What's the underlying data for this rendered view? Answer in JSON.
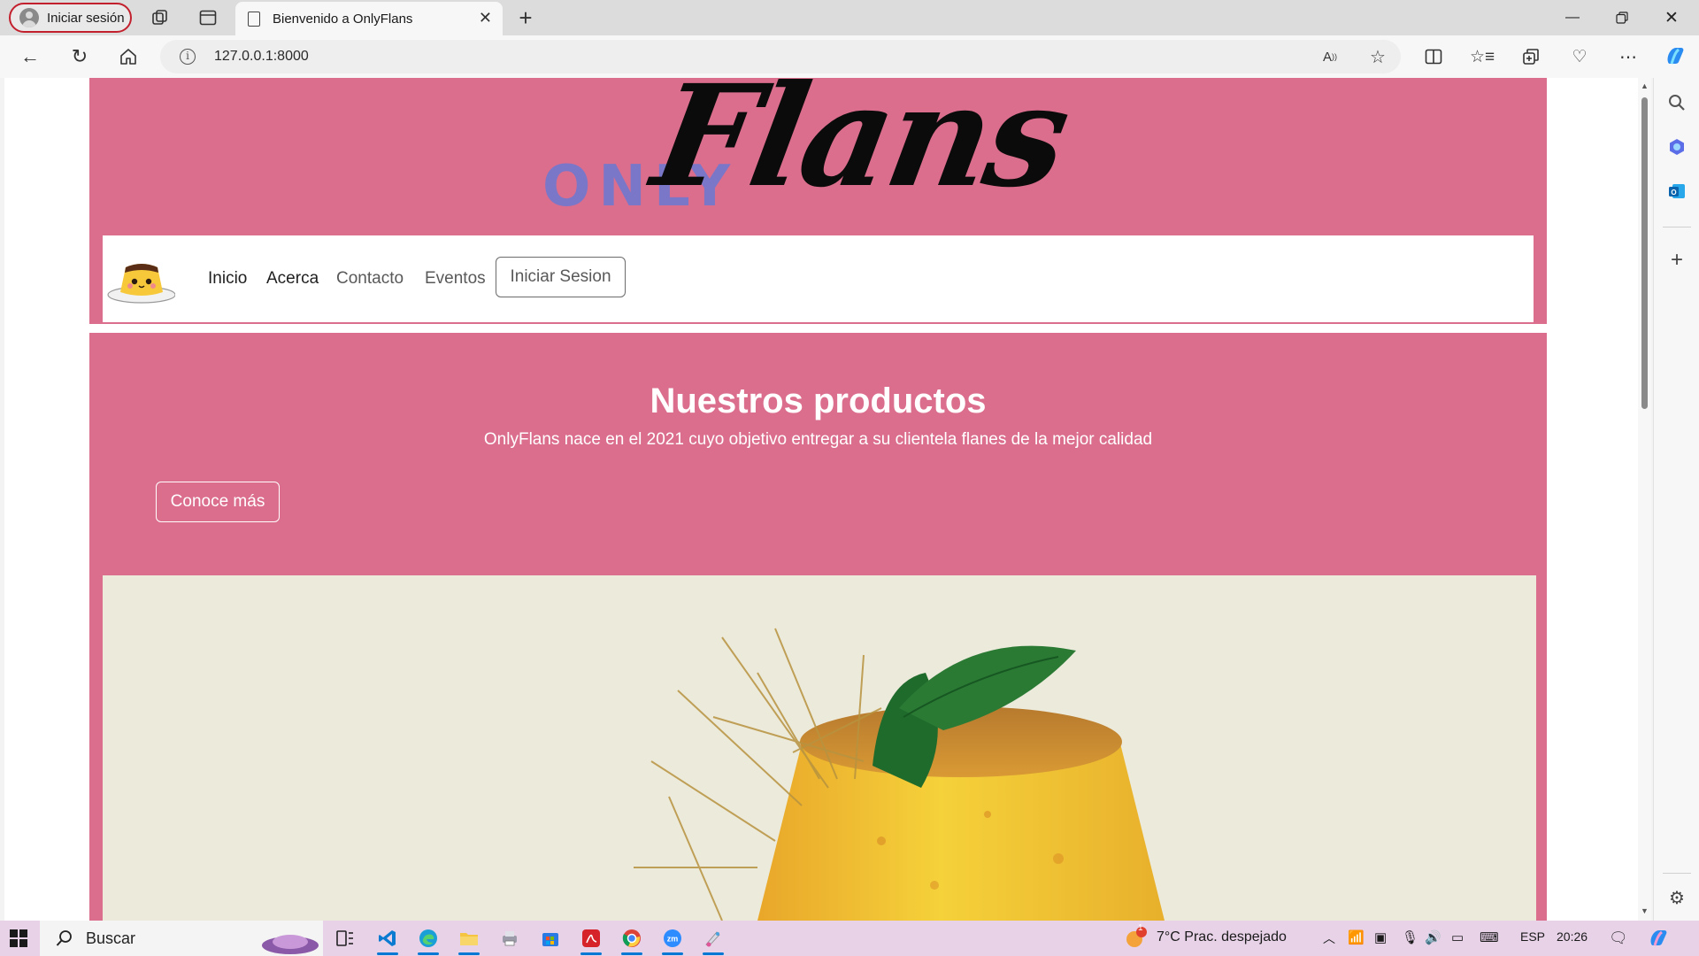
{
  "browser": {
    "profile_label": "Iniciar sesión",
    "tab_title": "Bienvenido a OnlyFlans",
    "url": "127.0.0.1:8000",
    "window_controls": [
      "minimize-icon",
      "restore-icon",
      "close-icon"
    ]
  },
  "site": {
    "logo": {
      "only": "ONLY",
      "flans": "Flans"
    },
    "nav": {
      "links": [
        "Inicio",
        "Acerca",
        "Contacto",
        "Eventos"
      ],
      "button": "Iniciar Sesion"
    },
    "hero": {
      "title": "Nuestros productos",
      "text": "OnlyFlans nace en el 2021 cuyo objetivo entregar a su clientela flanes de la mejor calidad",
      "button": "Conoce más"
    },
    "colors": {
      "brand_pink": "#db6d8d",
      "logo_only": "#7a77c9",
      "logo_flans": "#0b0b0b"
    }
  },
  "taskbar": {
    "search_label": "Buscar",
    "weather": "7°C  Prac. despejado",
    "weather_badge": "1",
    "language": "ESP",
    "time": "20:26"
  }
}
